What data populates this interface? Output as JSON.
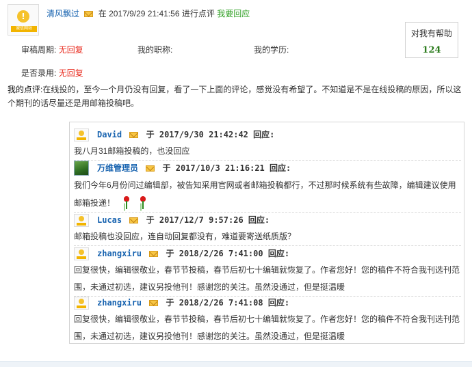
{
  "header": {
    "author": "清风飘过",
    "pre_date": "在",
    "datetime": "2017/9/29 21:41:56",
    "post_date": "进行点评",
    "reply_link": "我要回应",
    "avatar_site_text": "诚信网站"
  },
  "helpful": {
    "title": "对我有帮助",
    "count": "124"
  },
  "meta": {
    "review_period_label": "审稿周期:",
    "review_period_value": "无回复",
    "title_label": "我的职称:",
    "education_label": "我的学历:",
    "accepted_label": "是否录用:",
    "accepted_value": "无回复"
  },
  "review": {
    "label": "我的点评:",
    "text": "在线投的，至今一个月仍没有回复，看了一下上面的评论，感觉没有希望了。不知道是不是在线投稿的原因，所以这个期刊的话尽量还是用邮箱投稿吧。"
  },
  "replies": [
    {
      "name": "David",
      "datetime": "2017/9/30 21:42:42",
      "text": "我八月31邮箱投稿的，也没回应"
    },
    {
      "name": "万维管理员",
      "datetime": "2017/10/3 21:16:21",
      "text": "我们今年6月份问过编辑部，被告知采用官网或者邮箱投稿都行，不过那时候系统有些故障，编辑建议使用邮箱投递！"
    },
    {
      "name": "Lucas",
      "datetime": "2017/12/7 9:57:26",
      "text": "邮箱投稿也没回应，连自动回复都没有，难道要寄送纸质版？"
    },
    {
      "name": "zhangxiru",
      "datetime": "2018/2/26 7:41:00",
      "text": "回复很快，编辑很敬业，春节节投稿，春节后初七十编辑就恢复了。作者您好！您的稿件不符合我刊选刊范围，未通过初选，建议另投他刊！感谢您的关注。虽然没通过，但是挺温暖"
    },
    {
      "name": "zhangxiru",
      "datetime": "2018/2/26 7:41:08",
      "text": "回复很快，编辑很敬业，春节节投稿，春节后初七十编辑就恢复了。作者您好！您的稿件不符合我刊选刊范围，未通过初选，建议另投他刊！感谢您的关注。虽然没通过，但是挺温暖"
    }
  ],
  "labels": {
    "yu": "于",
    "respond": "回应:"
  }
}
